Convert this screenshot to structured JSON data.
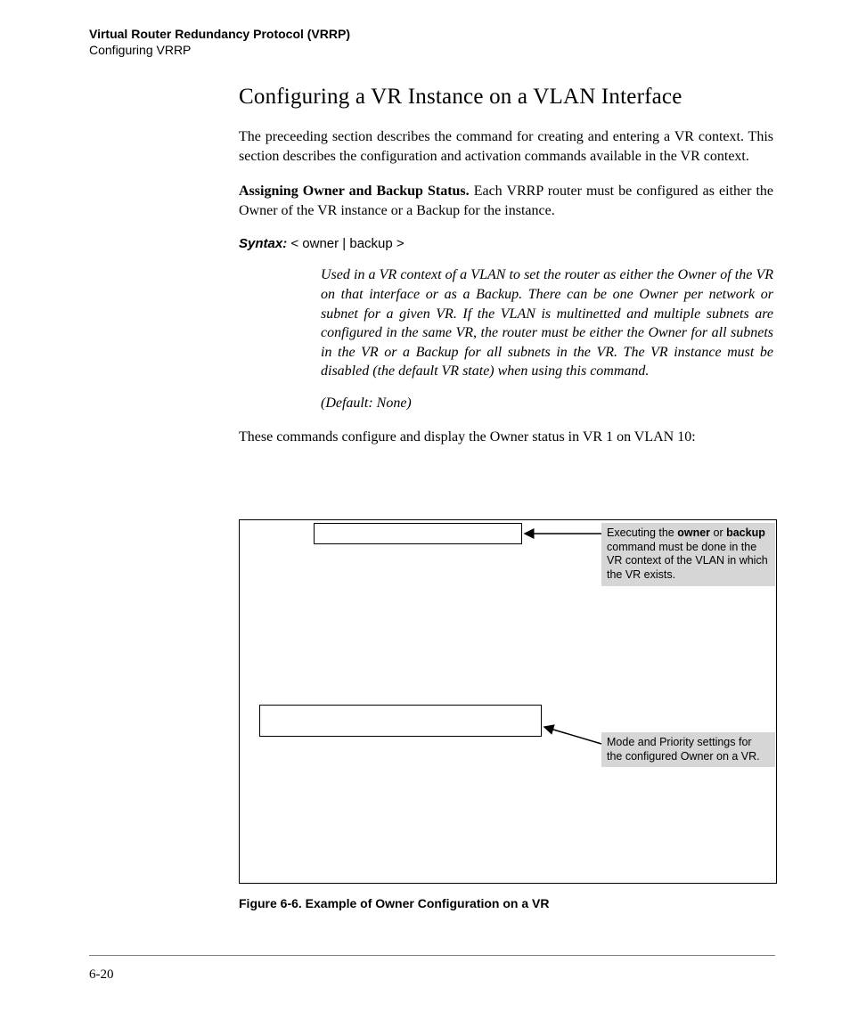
{
  "header": {
    "line1": "Virtual Router Redundancy Protocol (VRRP)",
    "line2": "Configuring VRRP"
  },
  "section_title": "Configuring a VR Instance on a VLAN Interface",
  "para1": "The preceeding section describes the command for creating and entering a VR context. This section describes the configuration and activation commands available in the VR context.",
  "para2_runin": "Assigning Owner and Backup Status.",
  "para2_rest": "  Each VRRP router must be configured as either the Owner of the VR instance or a Backup for the instance.",
  "syntax": {
    "label": "Syntax:",
    "cmd": "   < owner | backup >",
    "desc": "Used in a VR context of a VLAN to set the router as either the Owner of the VR on that interface or as a Backup. There can be one Owner per network or subnet for a given VR. If the VLAN is multinetted and multiple subnets are configured in the same VR, the router must be either the Owner for all subnets in the VR or a Backup for all subnets in the VR. The VR instance must be disabled (the default VR state) when using this command.",
    "default": "(Default: None)"
  },
  "para3": "These commands configure and display the Owner status in VR 1 on VLAN 10:",
  "callouts": {
    "a_pre": "Executing the ",
    "a_b1": "owner",
    "a_mid": " or ",
    "a_b2": "backup",
    "a_post": " command must be done in the VR context of the VLAN in which the VR exists.",
    "b": "Mode and Priority settings for the configured Owner on a VR."
  },
  "figure_caption": "Figure 6-6. Example of Owner Configuration on a VR",
  "page_number": "6-20"
}
